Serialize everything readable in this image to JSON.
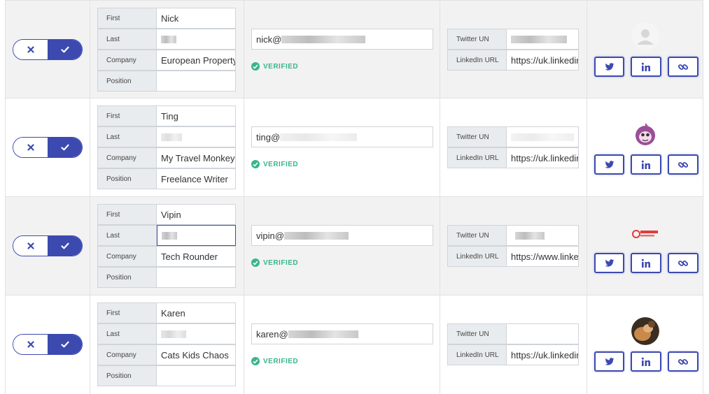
{
  "labels": {
    "first": "First",
    "last": "Last",
    "company": "Company",
    "position": "Position",
    "twitter": "Twitter UN",
    "linkedin": "LinkedIn URL",
    "verified": "VERIFIED"
  },
  "colors": {
    "accent": "#3c4ab0",
    "verified": "#3ab58a",
    "shaded_row": "#f2f2f2"
  },
  "icons": {
    "reject": "close-icon",
    "approve": "check-icon",
    "twitter": "twitter-icon",
    "linkedin": "linkedin-icon",
    "link": "link-icon",
    "verified": "check-circle-icon"
  },
  "contacts": [
    {
      "first": "Nick",
      "last": "",
      "company": "European Property",
      "position": "",
      "email_prefix": "nick@",
      "verified": true,
      "twitter": "",
      "linkedin": "https://uk.linkedin",
      "avatar": "default-avatar"
    },
    {
      "first": "Ting",
      "last": "",
      "company": "My Travel Monkey",
      "position": "Freelance Writer",
      "email_prefix": "ting@",
      "verified": true,
      "twitter": "",
      "linkedin": "https://uk.linkedin",
      "avatar": "monkey-logo"
    },
    {
      "first": "Vipin",
      "last": "",
      "company": "Tech Rounder",
      "position": "",
      "email_prefix": "vipin@",
      "verified": true,
      "twitter": "",
      "linkedin": "https://www.linkec",
      "avatar": "tech-rounder-logo"
    },
    {
      "first": "Karen",
      "last": "",
      "company": "Cats Kids Chaos",
      "position": "",
      "email_prefix": "karen@",
      "verified": true,
      "twitter": "",
      "linkedin": "https://uk.linkedin",
      "avatar": "profile-photo"
    }
  ]
}
